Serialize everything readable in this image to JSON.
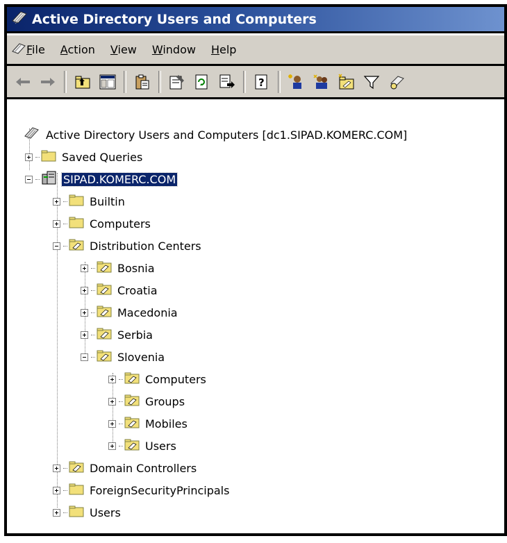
{
  "window": {
    "title": "Active Directory Users and Computers"
  },
  "menu": [
    {
      "pre": "",
      "mn": "F",
      "post": "ile"
    },
    {
      "pre": "",
      "mn": "A",
      "post": "ction"
    },
    {
      "pre": "",
      "mn": "V",
      "post": "iew"
    },
    {
      "pre": "",
      "mn": "W",
      "post": "indow"
    },
    {
      "pre": "",
      "mn": "H",
      "post": "elp"
    }
  ],
  "tree": {
    "root": "Active Directory Users and Computers [dc1.SIPAD.KOMERC.COM]",
    "saved_queries": "Saved Queries",
    "domain": "SIPAD.KOMERC.COM",
    "builtin": "Builtin",
    "computers": "Computers",
    "distribution_centers": "Distribution Centers",
    "bosnia": "Bosnia",
    "croatia": "Croatia",
    "macedonia": "Macedonia",
    "serbia": "Serbia",
    "slovenia": "Slovenia",
    "slo_computers": "Computers",
    "slo_groups": "Groups",
    "slo_mobiles": "Mobiles",
    "slo_users": "Users",
    "domain_controllers": "Domain Controllers",
    "foreign_security": "ForeignSecurityPrincipals",
    "users": "Users"
  },
  "colors": {
    "title_bar": "#0a246a",
    "chrome": "#d4d0c8",
    "selection": "#0a246a",
    "folder": "#f2e07a"
  }
}
